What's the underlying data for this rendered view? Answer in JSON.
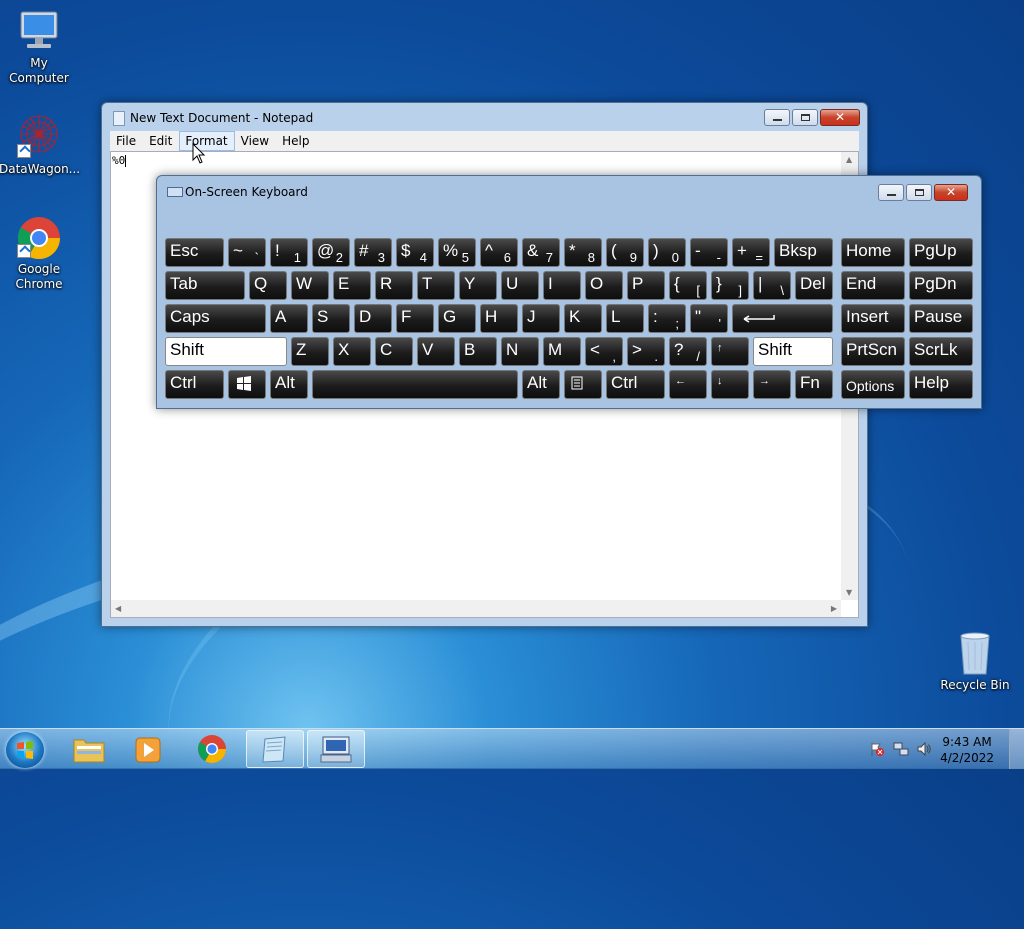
{
  "desktop": {
    "icons": [
      {
        "label": "My Computer"
      },
      {
        "label": "DataWagon..."
      },
      {
        "label_line1": "Google",
        "label_line2": "Chrome"
      },
      {
        "label": "Recycle Bin"
      }
    ]
  },
  "notepad": {
    "title": "New Text Document - Notepad",
    "menu": [
      "File",
      "Edit",
      "Format",
      "View",
      "Help"
    ],
    "hovered_menu": "Format",
    "content": "%0"
  },
  "osk": {
    "title": "On-Screen Keyboard",
    "rows": [
      [
        {
          "main": "Esc"
        },
        {
          "main": "~",
          "sub": "`"
        },
        {
          "main": "!",
          "sub": "1"
        },
        {
          "main": "@",
          "sub": "2"
        },
        {
          "main": "#",
          "sub": "3"
        },
        {
          "main": "$",
          "sub": "4"
        },
        {
          "main": "%",
          "sub": "5"
        },
        {
          "main": "^",
          "sub": "6"
        },
        {
          "main": "&",
          "sub": "7"
        },
        {
          "main": "*",
          "sub": "8"
        },
        {
          "main": "(",
          "sub": "9"
        },
        {
          "main": ")",
          "sub": "0"
        },
        {
          "main": "-",
          "sub": "-"
        },
        {
          "main": "+",
          "sub": "="
        },
        {
          "main": "Bksp"
        },
        {
          "main": "Home"
        },
        {
          "main": "PgUp"
        }
      ],
      [
        {
          "main": "Tab"
        },
        {
          "main": "Q"
        },
        {
          "main": "W"
        },
        {
          "main": "E"
        },
        {
          "main": "R"
        },
        {
          "main": "T"
        },
        {
          "main": "Y"
        },
        {
          "main": "U"
        },
        {
          "main": "I"
        },
        {
          "main": "O"
        },
        {
          "main": "P"
        },
        {
          "main": "{",
          "sub": "["
        },
        {
          "main": "}",
          "sub": "]"
        },
        {
          "main": "|",
          "sub": "\\"
        },
        {
          "main": "Del"
        },
        {
          "main": "End"
        },
        {
          "main": "PgDn"
        }
      ],
      [
        {
          "main": "Caps"
        },
        {
          "main": "A"
        },
        {
          "main": "S"
        },
        {
          "main": "D"
        },
        {
          "main": "F"
        },
        {
          "main": "G"
        },
        {
          "main": "H"
        },
        {
          "main": "J"
        },
        {
          "main": "K"
        },
        {
          "main": "L"
        },
        {
          "main": ":",
          "sub": ";"
        },
        {
          "main": "\"",
          "sub": "'"
        },
        {
          "main": "",
          "icon": "enter-arrow-icon"
        },
        {
          "main": "Insert"
        },
        {
          "main": "Pause"
        }
      ],
      [
        {
          "main": "Shift",
          "active": true
        },
        {
          "main": "Z"
        },
        {
          "main": "X"
        },
        {
          "main": "C"
        },
        {
          "main": "V"
        },
        {
          "main": "B"
        },
        {
          "main": "N"
        },
        {
          "main": "M"
        },
        {
          "main": "<",
          "sub": ","
        },
        {
          "main": ">",
          "sub": "."
        },
        {
          "main": "?",
          "sub": "/"
        },
        {
          "main": "↑",
          "small": true
        },
        {
          "main": "Shift",
          "active": true
        },
        {
          "main": "PrtScn"
        },
        {
          "main": "ScrLk"
        }
      ],
      [
        {
          "main": "Ctrl"
        },
        {
          "main": "",
          "icon": "windows-logo-icon"
        },
        {
          "main": "Alt"
        },
        {
          "main": ""
        },
        {
          "main": "Alt"
        },
        {
          "main": "",
          "icon": "menu-icon"
        },
        {
          "main": "Ctrl"
        },
        {
          "main": "←",
          "small": true
        },
        {
          "main": "↓",
          "small": true
        },
        {
          "main": "→",
          "small": true
        },
        {
          "main": "Fn"
        },
        {
          "main": "Options",
          "option": true
        },
        {
          "main": "Help"
        }
      ]
    ]
  },
  "taskbar": {
    "pinned": [
      "windows-explorer-icon",
      "media-player-icon",
      "chrome-icon",
      "notepad-icon",
      "on-screen-keyboard-icon"
    ],
    "clock_time": "9:43 AM",
    "clock_date": "4/2/2022"
  },
  "colors": {
    "accent": "#1667b8",
    "key": "#1c1c1c",
    "key_active": "#ffffff"
  }
}
